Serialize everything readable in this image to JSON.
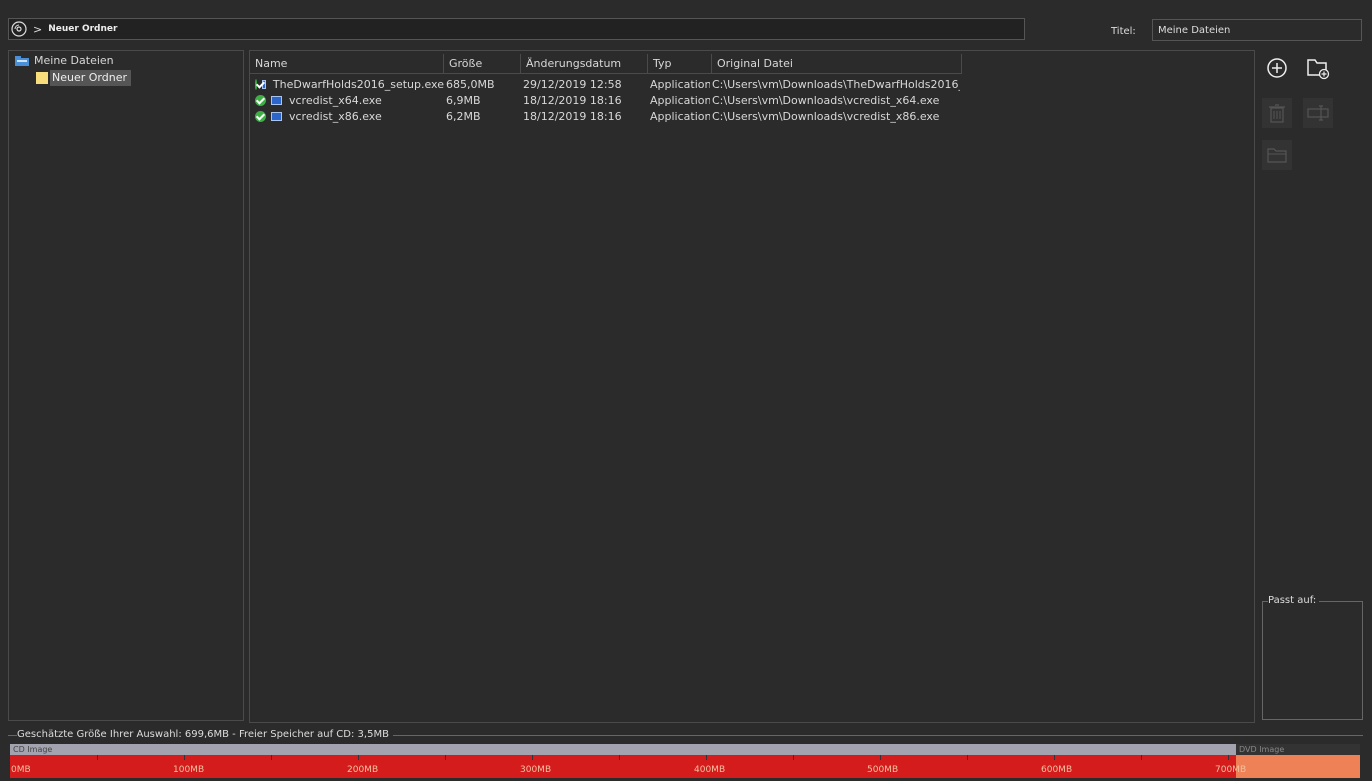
{
  "path": {
    "current": "Neuer Ordner"
  },
  "title": {
    "label": "Titel:",
    "value": "Meine Dateien"
  },
  "tree": {
    "root": "Meine Dateien",
    "children": [
      "Neuer Ordner"
    ]
  },
  "list": {
    "columns": [
      "Name",
      "Größe",
      "Änderungsdatum",
      "Typ",
      "Original Datei"
    ],
    "rows": [
      {
        "name": "TheDwarfHolds2016_setup.exe",
        "size": "685,0MB",
        "date": "29/12/2019 12:58",
        "type": "Application",
        "original": "C:\\Users\\vm\\Downloads\\TheDwarfHolds2016_..."
      },
      {
        "name": "vcredist_x64.exe",
        "size": "6,9MB",
        "date": "18/12/2019 18:16",
        "type": "Application",
        "original": "C:\\Users\\vm\\Downloads\\vcredist_x64.exe"
      },
      {
        "name": "vcredist_x86.exe",
        "size": "6,2MB",
        "date": "18/12/2019 18:16",
        "type": "Application",
        "original": "C:\\Users\\vm\\Downloads\\vcredist_x86.exe"
      }
    ]
  },
  "passt": {
    "label": "Passt auf:"
  },
  "estimate": {
    "text": "Geschätzte Größe Ihrer Auswahl: 699,6MB - Freier Speicher auf CD: 3,5MB"
  },
  "meter": {
    "cd_label": "CD Image",
    "dvd_label": "DVD Image",
    "ticks": [
      "0MB",
      "100MB",
      "200MB",
      "300MB",
      "400MB",
      "500MB",
      "600MB",
      "700MB"
    ],
    "cd_capacity_mb": 703.1,
    "used_mb": 699.6
  },
  "colors": {
    "used": "#d41c1c",
    "over": "#ee8155",
    "ok": "#3cb043"
  }
}
